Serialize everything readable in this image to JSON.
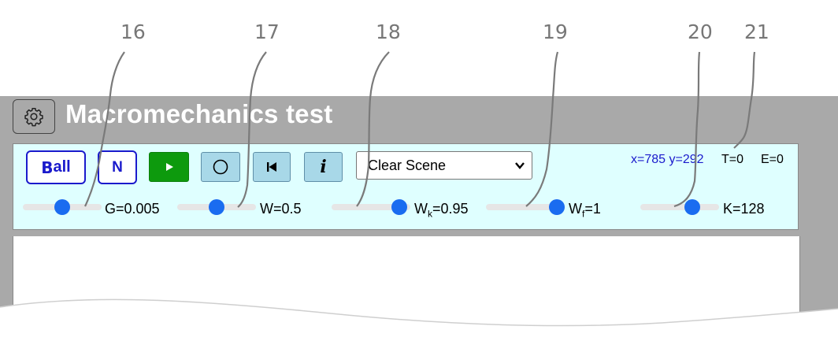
{
  "callouts": [
    "16",
    "17",
    "18",
    "19",
    "20",
    "21"
  ],
  "app": {
    "title": "Macromechanics test",
    "settings_icon": "gear-icon"
  },
  "toolbar": {
    "ball_label_b": "B",
    "ball_label_rest": "all",
    "n_label": "N",
    "play_icon": "play-icon",
    "circle_icon": "circle-icon",
    "reset_icon": "skip-back-icon",
    "info_label": "i",
    "scene_select": {
      "selected": "Clear Scene"
    },
    "coords": "x=785 y=292",
    "time": "T=0",
    "energy": "E=0"
  },
  "sliders": [
    {
      "name": "G",
      "label": "G=0.005",
      "level": 0.5
    },
    {
      "name": "W",
      "label": "W=0.5",
      "level": 0.5
    },
    {
      "name": "Wk",
      "label_main": "W",
      "label_sub": "k",
      "label_value": "=0.95",
      "level": 0.95
    },
    {
      "name": "Wf",
      "label_main": "W",
      "label_sub": "f",
      "label_value": "=1",
      "level": 1.0
    },
    {
      "name": "K",
      "label": "K=128",
      "level": 0.7
    }
  ],
  "colors": {
    "frame": "#a9a9a9",
    "toolbar_bg": "#dfffff",
    "accent_blue": "#1a1acc",
    "play_green": "#0d9a0d",
    "slider_thumb": "#1a6cf0"
  }
}
